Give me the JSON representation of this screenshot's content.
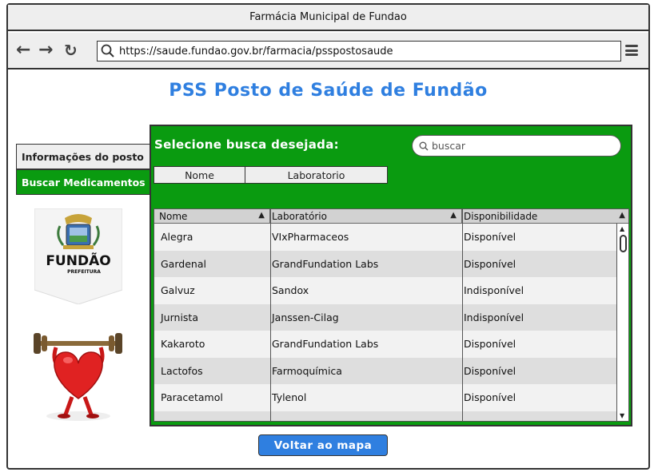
{
  "window": {
    "title": "Farmácia Municipal de Fundao"
  },
  "navbar": {
    "back_icon": "arrow-left-icon",
    "forward_icon": "arrow-right-icon",
    "reload_icon": "reload-icon",
    "url": "https://saude.fundao.gov.br/farmacia/psspostosaude",
    "menu_icon": "hamburger-menu-icon"
  },
  "page": {
    "title": "PSS Posto de Saúde de Fundão"
  },
  "sidebar": {
    "tabs": [
      {
        "label": "Informações do posto",
        "active": false
      },
      {
        "label": "Buscar Medicamentos",
        "active": true
      }
    ]
  },
  "logo": {
    "text": "FUNDÃO",
    "subtext": "PREFEITURA"
  },
  "search_panel": {
    "label": "Selecione busca desejada:",
    "search_placeholder": "buscar",
    "segments": [
      "Nome",
      "Laboratorio"
    ]
  },
  "table": {
    "columns": [
      "Nome",
      "Laboratório",
      "Disponibilidade"
    ],
    "rows": [
      [
        "Alegra",
        "VIxPharmaceos",
        "Disponível"
      ],
      [
        "Gardenal",
        "GrandFundation Labs",
        "Disponível"
      ],
      [
        "Galvuz",
        "Sandox",
        "Indisponível"
      ],
      [
        "Jurnista",
        "Janssen-Cilag",
        "Indisponível"
      ],
      [
        "Kakaroto",
        "GrandFundation Labs",
        "Disponível"
      ],
      [
        "Lactofos",
        "Farmoquímica",
        "Disponível"
      ],
      [
        "Paracetamol",
        "Tylenol",
        "Disponível"
      ]
    ]
  },
  "footer": {
    "back_button": "Voltar ao mapa"
  },
  "colors": {
    "accent": "#2f7fe0",
    "panel_green": "#0a9b10"
  }
}
